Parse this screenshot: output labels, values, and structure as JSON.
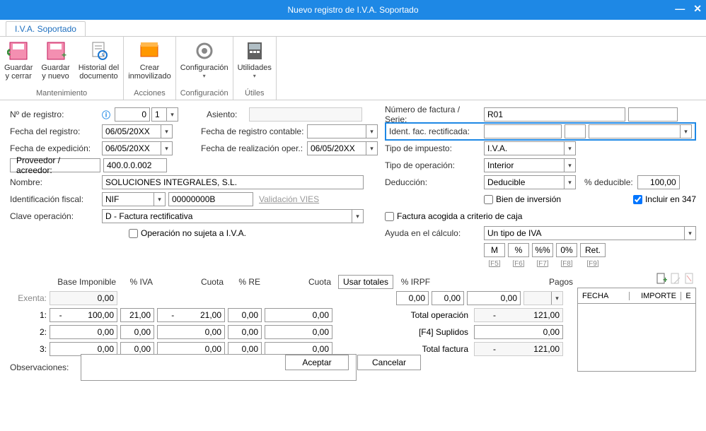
{
  "window": {
    "title": "Nuevo registro de I.V.A. Soportado"
  },
  "tab": {
    "label": "I.V.A. Soportado"
  },
  "ribbon": {
    "groups": {
      "mantenimiento": {
        "label": "Mantenimiento",
        "save_close": "Guardar\ny cerrar",
        "save_new": "Guardar\ny nuevo",
        "history": "Historial del\ndocumento"
      },
      "acciones": {
        "label": "Acciones",
        "crear": "Crear\ninmovilizado"
      },
      "configuracion": {
        "label": "Configuración",
        "config": "Configuración"
      },
      "utiles": {
        "label": "Útiles",
        "util": "Utilidades"
      }
    }
  },
  "form": {
    "n_registro_lbl": "Nº de registro:",
    "n_registro_val": "0",
    "n_registro_serie": "1",
    "fecha_registro_lbl": "Fecha del registro:",
    "fecha_registro_val": "06/05/20XX",
    "fecha_expedicion_lbl": "Fecha de expedición:",
    "fecha_expedicion_val": "06/05/20XX",
    "proveedor_lbl": "Proveedor / acreedor:",
    "proveedor_val": "400.0.0.002",
    "nombre_lbl": "Nombre:",
    "nombre_val": "SOLUCIONES INTEGRALES, S.L.",
    "ident_fiscal_lbl": "Identificación fiscal:",
    "ident_fiscal_tipo": "NIF",
    "ident_fiscal_val": "00000000B",
    "validacion_vies": "Validación VIES",
    "clave_op_lbl": "Clave operación:",
    "clave_op_val": "D - Factura rectificativa",
    "op_no_sujeta": "Operación no sujeta a I.V.A.",
    "asiento_lbl": "Asiento:",
    "fecha_reg_contable_lbl": "Fecha de registro contable:",
    "fecha_realizacion_lbl": "Fecha de realización oper.:",
    "fecha_realizacion_val": "06/05/20XX",
    "num_factura_lbl": "Número de factura / Serie:",
    "num_factura_val": "R01",
    "ident_rectif_lbl": "Ident. fac. rectificada:",
    "tipo_impuesto_lbl": "Tipo de impuesto:",
    "tipo_impuesto_val": "I.V.A.",
    "tipo_operacion_lbl": "Tipo de operación:",
    "tipo_operacion_val": "Interior",
    "deduccion_lbl": "Deducción:",
    "deduccion_val": "Deducible",
    "pct_deducible_lbl": "% deducible:",
    "pct_deducible_val": "100,00",
    "bien_inversion": "Bien de inversión",
    "incluir_347": "Incluir en 347",
    "factura_caja": "Factura acogida a criterio de caja",
    "ayuda_calc_lbl": "Ayuda en el cálculo:",
    "ayuda_calc_val": "Un tipo de IVA",
    "calc_btns": {
      "m": "M",
      "pct": "%",
      "pctpct": "%%",
      "zero": "0%",
      "ret": "Ret."
    },
    "fkeys": {
      "f5": "[F5]",
      "f6": "[F6]",
      "f7": "[F7]",
      "f8": "[F8]",
      "f9": "[F9]"
    }
  },
  "grid": {
    "headers": {
      "base": "Base Imponible",
      "pct_iva": "% IVA",
      "cuota": "Cuota",
      "pct_re": "% RE",
      "cuota2": "Cuota",
      "usar": "Usar totales",
      "pct_irpf": "% IRPF",
      "pagos": "Pagos"
    },
    "rows": {
      "exenta_lbl": "Exenta:",
      "exenta": "0,00",
      "r1_lbl": "1:",
      "r1": {
        "base": "-           100,00",
        "pct_iva": "21,00",
        "cuota": "-           21,00",
        "pct_re": "0,00",
        "cuota2": "0,00"
      },
      "r2_lbl": "2:",
      "r2": {
        "base": "0,00",
        "pct_iva": "0,00",
        "cuota": "0,00",
        "pct_re": "0,00",
        "cuota2": "0,00"
      },
      "r3_lbl": "3:",
      "r3": {
        "base": "0,00",
        "pct_iva": "0,00",
        "cuota": "0,00",
        "pct_re": "0,00",
        "cuota2": "0,00"
      }
    },
    "irpf_row": {
      "v1": "0,00",
      "v2": "0,00",
      "v3": "0,00"
    },
    "totals": {
      "total_op_lbl": "Total operación",
      "total_op_val": "-                121,00",
      "suplidos_lbl": "[F4] Suplidos",
      "suplidos_val": "0,00",
      "total_fac_lbl": "Total factura",
      "total_fac_val": "-                121,00"
    },
    "observaciones_lbl": "Observaciones:"
  },
  "pagos": {
    "headers": {
      "fecha": "FECHA",
      "importe": "IMPORTE",
      "e": "E"
    }
  },
  "buttons": {
    "aceptar": "Aceptar",
    "cancelar": "Cancelar"
  }
}
